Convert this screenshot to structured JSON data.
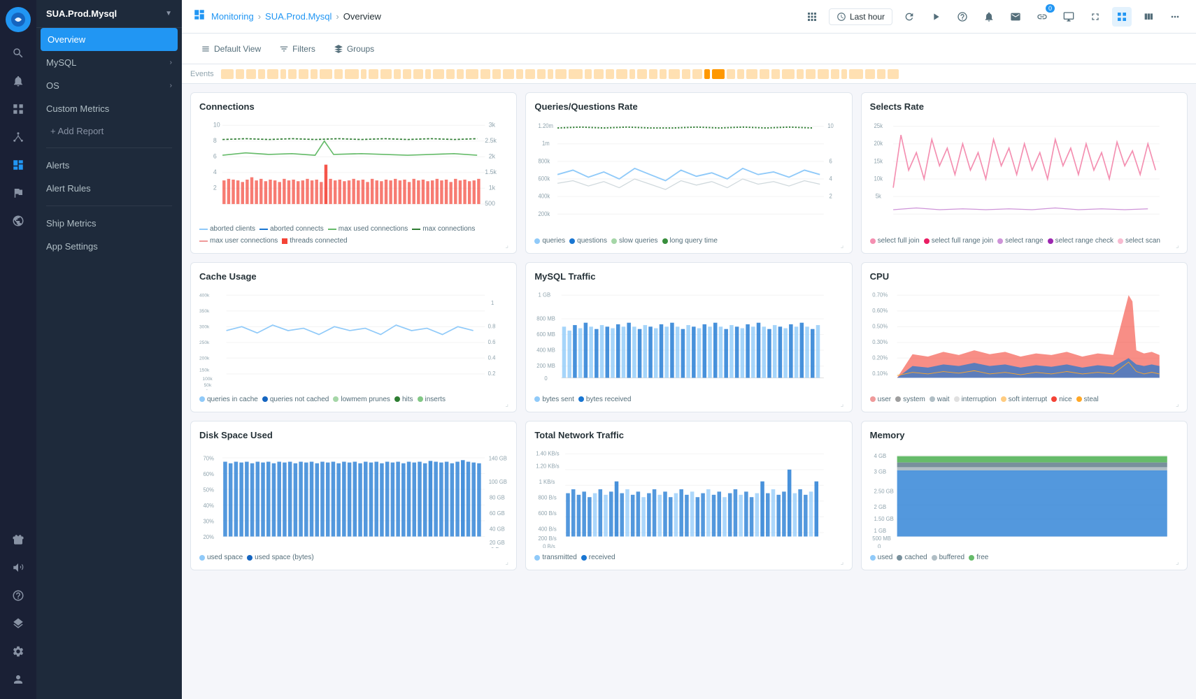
{
  "app": {
    "logo": "∿",
    "instance": "SUA.Prod.Mysql"
  },
  "breadcrumb": {
    "monitoring": "Monitoring",
    "instance": "SUA.Prod.Mysql",
    "page": "Overview"
  },
  "topnav": {
    "last_hour_label": "Last hour",
    "notification_count": "0"
  },
  "toolbar": {
    "default_view": "Default View",
    "filters": "Filters",
    "groups": "Groups"
  },
  "events": {
    "label": "Events"
  },
  "sidebar": {
    "instance": "SUA.Prod.Mysql",
    "items": [
      {
        "id": "overview",
        "label": "Overview",
        "active": true
      },
      {
        "id": "mysql",
        "label": "MySQL",
        "hasChildren": true
      },
      {
        "id": "os",
        "label": "OS",
        "hasChildren": true
      },
      {
        "id": "custom-metrics",
        "label": "Custom Metrics"
      },
      {
        "id": "add-report",
        "label": "+ Add Report"
      },
      {
        "id": "alerts",
        "label": "Alerts"
      },
      {
        "id": "alert-rules",
        "label": "Alert Rules"
      },
      {
        "id": "ship-metrics",
        "label": "Ship Metrics"
      },
      {
        "id": "app-settings",
        "label": "App Settings"
      }
    ]
  },
  "charts": [
    {
      "id": "connections",
      "title": "Connections",
      "legend": [
        {
          "color": "#90caf9",
          "label": "aborted clients"
        },
        {
          "color": "#1976d2",
          "label": "aborted connects"
        },
        {
          "color": "#66bb6a",
          "label": "max used connections"
        },
        {
          "color": "#2e7d32",
          "label": "max connections"
        },
        {
          "color": "#ef9a9a",
          "label": "max user connections"
        },
        {
          "color": "#f44336",
          "label": "threads connected"
        }
      ]
    },
    {
      "id": "queries-rate",
      "title": "Queries/Questions Rate",
      "legend": [
        {
          "color": "#90caf9",
          "label": "queries"
        },
        {
          "color": "#1976d2",
          "label": "questions"
        },
        {
          "color": "#a5d6a7",
          "label": "slow queries"
        },
        {
          "color": "#388e3c",
          "label": "long query time"
        }
      ]
    },
    {
      "id": "selects-rate",
      "title": "Selects Rate",
      "legend": [
        {
          "color": "#f48fb1",
          "label": "select full join"
        },
        {
          "color": "#e91e63",
          "label": "select full range join"
        },
        {
          "color": "#ce93d8",
          "label": "select range"
        },
        {
          "color": "#9c27b0",
          "label": "select range check"
        },
        {
          "color": "#f8bbd0",
          "label": "select scan"
        }
      ]
    },
    {
      "id": "cache-usage",
      "title": "Cache Usage",
      "legend": [
        {
          "color": "#90caf9",
          "label": "queries in cache"
        },
        {
          "color": "#1565c0",
          "label": "queries not cached"
        },
        {
          "color": "#a5d6a7",
          "label": "lowmem prunes"
        },
        {
          "color": "#2e7d32",
          "label": "hits"
        },
        {
          "color": "#81c784",
          "label": "inserts"
        }
      ]
    },
    {
      "id": "mysql-traffic",
      "title": "MySQL Traffic",
      "legend": [
        {
          "color": "#90caf9",
          "label": "bytes sent"
        },
        {
          "color": "#1976d2",
          "label": "bytes received"
        }
      ]
    },
    {
      "id": "cpu",
      "title": "CPU",
      "legend": [
        {
          "color": "#ef9a9a",
          "label": "user"
        },
        {
          "color": "#9e9e9e",
          "label": "system"
        },
        {
          "color": "#b0bec5",
          "label": "wait"
        },
        {
          "color": "#e0e0e0",
          "label": "interruption"
        },
        {
          "color": "#ffcc80",
          "label": "soft interrupt"
        },
        {
          "color": "#f44336",
          "label": "nice"
        },
        {
          "color": "#ffa726",
          "label": "steal"
        }
      ]
    },
    {
      "id": "disk-space",
      "title": "Disk Space Used",
      "legend": [
        {
          "color": "#90caf9",
          "label": "used space"
        },
        {
          "color": "#1565c0",
          "label": "used space (bytes)"
        }
      ]
    },
    {
      "id": "network-traffic",
      "title": "Total Network Traffic",
      "legend": [
        {
          "color": "#90caf9",
          "label": "transmitted"
        },
        {
          "color": "#1976d2",
          "label": "received"
        }
      ]
    },
    {
      "id": "memory",
      "title": "Memory",
      "legend": [
        {
          "color": "#90caf9",
          "label": "used"
        },
        {
          "color": "#78909c",
          "label": "cached"
        },
        {
          "color": "#b0bec5",
          "label": "buffered"
        },
        {
          "color": "#66bb6a",
          "label": "free"
        }
      ]
    }
  ]
}
